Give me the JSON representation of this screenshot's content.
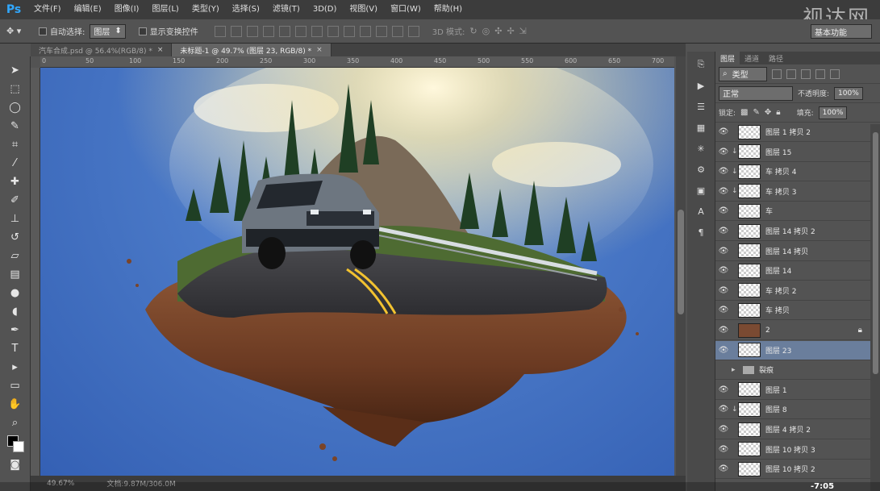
{
  "menubar": {
    "logo": "Ps",
    "items": [
      "文件(F)",
      "编辑(E)",
      "图像(I)",
      "图层(L)",
      "类型(Y)",
      "选择(S)",
      "滤镜(T)",
      "3D(D)",
      "视图(V)",
      "窗口(W)",
      "帮助(H)"
    ]
  },
  "watermark": "视达网",
  "options": {
    "auto_select_label": "自动选择:",
    "auto_select_value": "图层",
    "show_transform_label": "显示变换控件",
    "mode3d_label": "3D 模式:",
    "workspace": "基本功能"
  },
  "tabs": [
    {
      "label": "汽车合成.psd @ 56.4%(RGB/8) *"
    },
    {
      "label": "未标题-1 @ 49.7% (图层 23, RGB/8) *"
    }
  ],
  "ruler": {
    "ticks": [
      "0",
      "50",
      "100",
      "150",
      "200",
      "250",
      "300",
      "350",
      "400",
      "450",
      "500",
      "550",
      "600",
      "650",
      "700"
    ]
  },
  "status": {
    "zoom": "49.67%",
    "doc": "文档:9.87M/306.0M"
  },
  "layers_panel": {
    "tabs": [
      "图层",
      "通道",
      "路径"
    ],
    "filter_label": "类型",
    "blend_mode": "正常",
    "opacity_label": "不透明度:",
    "opacity_value": "100%",
    "lock_label": "锁定:",
    "fill_label": "填充:",
    "fill_value": "100%",
    "layers": [
      {
        "name": "图层 1 拷贝 2",
        "clip": false,
        "thumb": "trans",
        "lock": false,
        "selected": false
      },
      {
        "name": "图层 15",
        "clip": true,
        "thumb": "trans",
        "lock": false,
        "selected": false
      },
      {
        "name": "车 拷贝 4",
        "clip": true,
        "thumb": "trans",
        "lock": false,
        "selected": false
      },
      {
        "name": "车 拷贝 3",
        "clip": true,
        "thumb": "trans",
        "lock": false,
        "selected": false
      },
      {
        "name": "车",
        "clip": false,
        "thumb": "trans",
        "lock": false,
        "selected": false
      },
      {
        "name": "图层 14 拷贝 2",
        "clip": false,
        "thumb": "trans",
        "lock": false,
        "selected": false
      },
      {
        "name": "图层 14 拷贝",
        "clip": false,
        "thumb": "trans",
        "lock": false,
        "selected": false
      },
      {
        "name": "图层 14",
        "clip": false,
        "thumb": "trans",
        "lock": false,
        "selected": false
      },
      {
        "name": "车 拷贝 2",
        "clip": false,
        "thumb": "trans",
        "lock": false,
        "selected": false
      },
      {
        "name": "车 拷贝",
        "clip": false,
        "thumb": "trans",
        "lock": false,
        "selected": false
      },
      {
        "name": "2",
        "clip": false,
        "thumb": "rock",
        "lock": true,
        "selected": false
      },
      {
        "name": "图层 23",
        "clip": false,
        "thumb": "trans",
        "lock": false,
        "selected": true
      },
      {
        "name": "裂痕",
        "clip": false,
        "thumb": "folder",
        "lock": false,
        "selected": false
      },
      {
        "name": "图层 1",
        "clip": false,
        "thumb": "trans",
        "lock": false,
        "selected": false
      },
      {
        "name": "图层 8",
        "clip": true,
        "thumb": "trans",
        "lock": false,
        "selected": false
      },
      {
        "name": "图层 4 拷贝 2",
        "clip": false,
        "thumb": "trans",
        "lock": false,
        "selected": false
      },
      {
        "name": "图层 10 拷贝 3",
        "clip": false,
        "thumb": "trans",
        "lock": false,
        "selected": false
      },
      {
        "name": "图层 10 拷贝 2",
        "clip": false,
        "thumb": "trans",
        "lock": false,
        "selected": false
      }
    ]
  },
  "video": {
    "time": "-7:05"
  },
  "colors": {
    "canvas_bg": "#4b7ac8",
    "selected_layer": "#6a7e9c",
    "ps_blue": "#31a8ff"
  }
}
